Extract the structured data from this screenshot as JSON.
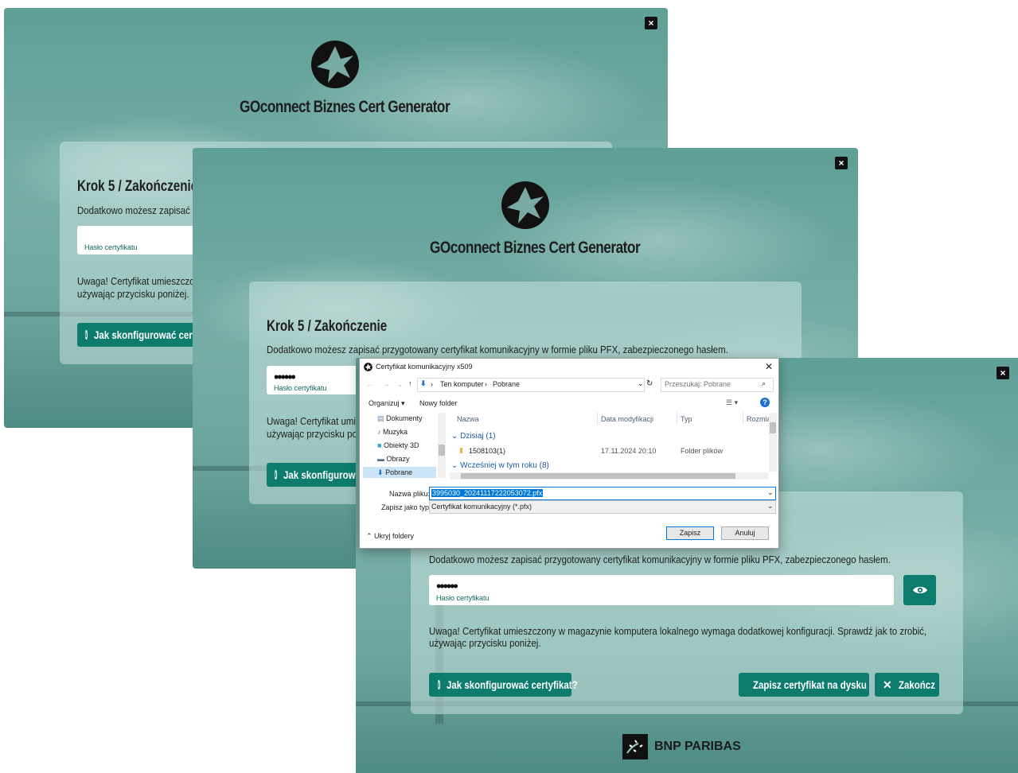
{
  "app": {
    "title": "GOconnect Biznes Cert Generator",
    "close_glyph": "×",
    "step_title": "Krok 5 / Zakończenie",
    "description": "Dodatkowo możesz zapisać przygotowany certyfikat komunikacyjny w formie pliku PFX, zabezpieczonego hasłem.",
    "description_clipped": "Dodatkowo możesz zapisać p",
    "password_value": "••••••",
    "password_label": "Hasło certyfikatu",
    "warning_line1": "Uwaga! Certyfikat umieszczony w magazynie komputera lokalnego wymaga dodatkowej konfiguracji. Sprawdź jak to zrobić,",
    "warning_line1_clip_a": "Uwaga! Certyfikat umieszczon",
    "warning_line1_clip_b": "Uwaga! Certyfikat umie",
    "warning_line2": "używając przycisku poniżej.",
    "warning_line2_clip_b": "używając przycisku po",
    "help_button": "Jak skonfigurować certyfikat?",
    "help_button_clip_a": "Jak skonfigurować certyfi",
    "help_button_clip_b": "Jak skonfigurowa",
    "save_button": "Zapisz certyfikat na dysku",
    "finish_button": "Zakończ",
    "footer_brand": "BNP PARIBAS",
    "accent": "#0d7c6f"
  },
  "dialog": {
    "title": "Certyfikat komunikacyjny x509",
    "breadcrumb": [
      "Ten komputer",
      "Pobrane"
    ],
    "search_placeholder": "Przeszukaj: Pobrane",
    "organize": "Organizuj",
    "new_folder": "Nowy folder",
    "sidebar": [
      "Dokumenty",
      "Muzyka",
      "Obiekty 3D",
      "Obrazy",
      "Pobrane"
    ],
    "columns": [
      "Nazwa",
      "Data modyfikacji",
      "Typ",
      "Rozmia"
    ],
    "group_today": "Dzisiaj (1)",
    "row_name": "1508103(1)",
    "row_date": "17.11.2024 20:10",
    "row_type": "Folder plików",
    "group_earlier": "Wcześniej w tym roku (8)",
    "filename_label": "Nazwa pliku:",
    "filename_value": "3995030_20241117222053072.pfx",
    "savetype_label": "Zapisz jako typ:",
    "savetype_value": "Certyfikat komunikacyjny (*.pfx)",
    "hide_folders": "Ukryj foldery",
    "save": "Zapisz",
    "cancel": "Anuluj"
  }
}
